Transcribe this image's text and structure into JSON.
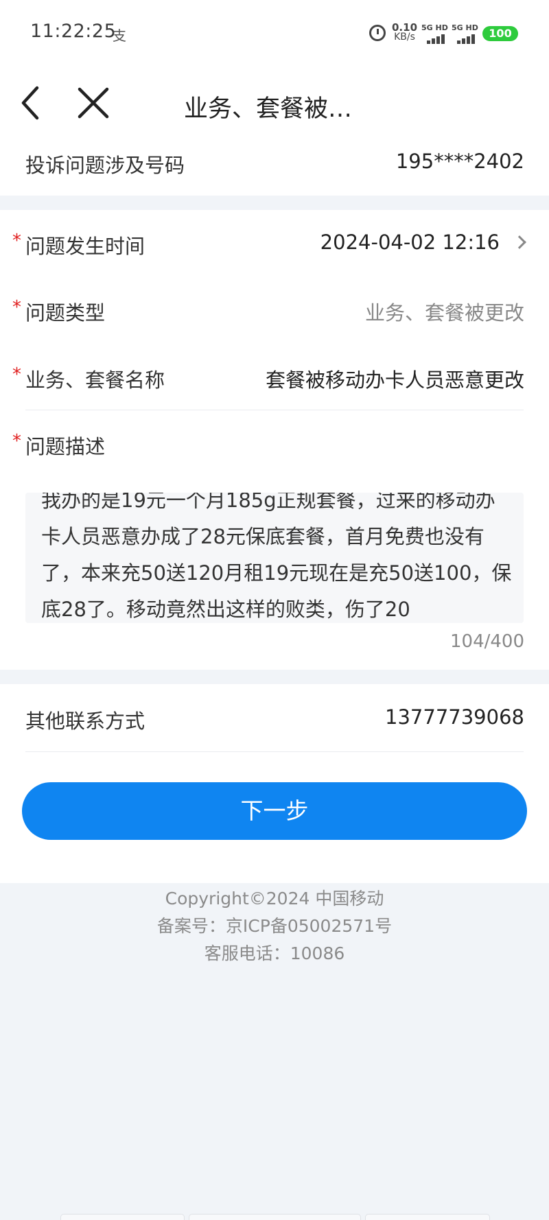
{
  "status_bar": {
    "time": "11:22:25",
    "pay_icon": "alipay-icon",
    "net_speed_value": "0.10",
    "net_speed_unit": "KB/s",
    "sim1": "5G HD",
    "sim2": "5G HD",
    "battery": "100"
  },
  "nav": {
    "title": "业务、套餐被…"
  },
  "form": {
    "phone_label": "投诉问题涉及号码",
    "phone_value": "195****2402",
    "required_mark": "*",
    "time_label": "问题发生时间",
    "time_value": "2024-04-02 12:16",
    "type_label": "问题类型",
    "type_value": "业务、套餐被更改",
    "service_label": "业务、套餐名称",
    "service_value": "套餐被移动办卡人员恶意更改",
    "desc_label": "问题描述",
    "desc_text": "我办的是19元一个月185g正规套餐，过来的移动办卡人员恶意办成了28元保底套餐，首月免费也没有了，本来充50送120月租19元现在是充50送100，保底28了。移动竟然出这样的败类，伤了20",
    "desc_counter": "104/400",
    "contact_label": "其他联系方式",
    "contact_value": "13777739068"
  },
  "next_button": "下一步",
  "footer": {
    "copyright": "Copyright©2024 中国移动",
    "icp": "备案号：京ICP备05002571号",
    "service_phone": "客服电话：10086"
  },
  "colors": {
    "primary": "#0f85f1",
    "required": "#e02020",
    "battery": "#2ecb3d",
    "page_bg": "#f1f4f8"
  }
}
